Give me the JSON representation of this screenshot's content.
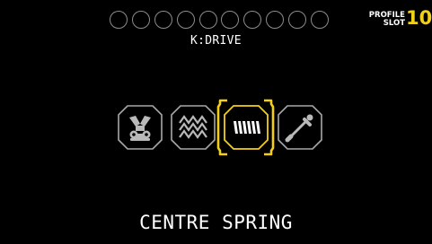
{
  "profile": {
    "label_line1": "PROFILE",
    "label_line2": "SLOT",
    "slot_number": "10",
    "indicator_dots": [
      {
        "filled": false
      },
      {
        "filled": false
      },
      {
        "filled": false
      },
      {
        "filled": false
      },
      {
        "filled": false
      },
      {
        "filled": false
      },
      {
        "filled": false
      },
      {
        "filled": false
      },
      {
        "filled": false
      },
      {
        "filled": false
      }
    ]
  },
  "header": {
    "mode_title": "K:DRIVE"
  },
  "modes": [
    {
      "name": "engine-mode",
      "icon": "engine-icon",
      "selected": false
    },
    {
      "name": "damper-mode",
      "icon": "zigzag-icon",
      "selected": false
    },
    {
      "name": "centre-spring-mode",
      "icon": "spring-icon",
      "selected": true
    },
    {
      "name": "shifter-mode",
      "icon": "gear-stick-icon",
      "selected": false
    }
  ],
  "footer": {
    "selected_label": "CENTRE SPRING"
  },
  "colors": {
    "background": "#000000",
    "accent": "#f2cf1b",
    "icon_border": "#a8a8a8",
    "dot_border": "#8c8c8c",
    "text": "#ffffff"
  }
}
